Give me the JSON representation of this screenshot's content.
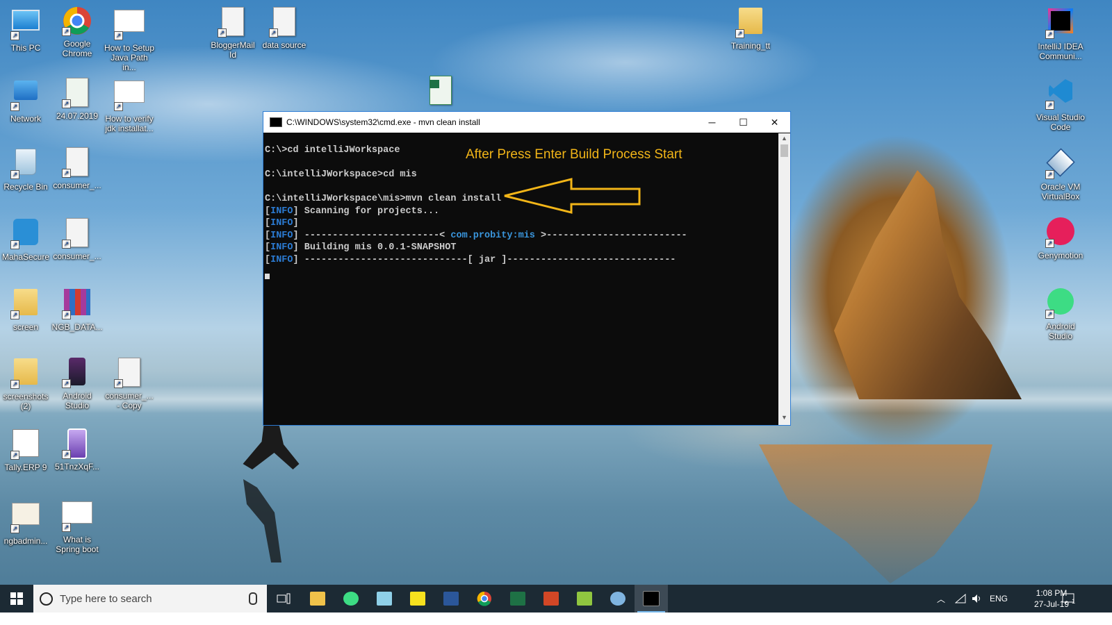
{
  "desktop": {
    "icons_left": [
      {
        "label": "This PC",
        "kind": "pc"
      },
      {
        "label": "Google Chrome",
        "kind": "chrome"
      },
      {
        "label": "How to Setup Java Path in...",
        "kind": "image"
      },
      {
        "label": "Network",
        "kind": "network"
      },
      {
        "label": "24.07.2019",
        "kind": "excel"
      },
      {
        "label": "How to verify jdk installat...",
        "kind": "image"
      },
      {
        "label": "Recycle Bin",
        "kind": "recycle"
      },
      {
        "label": "consumer_...",
        "kind": "doc"
      },
      {
        "label": "MahaSecure",
        "kind": "lock"
      },
      {
        "label": "consumer_...",
        "kind": "doc"
      },
      {
        "label": "screen",
        "kind": "folder"
      },
      {
        "label": "NGB_DATA...",
        "kind": "winrar"
      },
      {
        "label": "screenshots (2)",
        "kind": "folder"
      },
      {
        "label": "Android Studio",
        "kind": "phone"
      },
      {
        "label": "consumer_... - Copy",
        "kind": "doc"
      },
      {
        "label": "Tally.ERP 9",
        "kind": "tally"
      },
      {
        "label": "51TnzXqF...",
        "kind": "phone2"
      },
      {
        "label": "ngbadmin...",
        "kind": "cert"
      },
      {
        "label": "What is Spring boot",
        "kind": "image"
      }
    ],
    "icons_top": [
      {
        "label": "BloggerMail Id",
        "kind": "doc"
      },
      {
        "label": "data source",
        "kind": "doc"
      },
      {
        "label": "Training_tt",
        "kind": "folder"
      }
    ],
    "icons_right": [
      {
        "label": "IntelliJ IDEA Communi...",
        "kind": "intellij"
      },
      {
        "label": "Visual Studio Code",
        "kind": "vscode"
      },
      {
        "label": "Oracle VM VirtualBox",
        "kind": "vbox"
      },
      {
        "label": "Genymotion",
        "kind": "geny"
      },
      {
        "label": "Android Studio",
        "kind": "android"
      }
    ]
  },
  "cmd": {
    "title": "C:\\WINDOWS\\system32\\cmd.exe - mvn  clean install",
    "lines": {
      "l1": "C:\\>cd intelliJWorkspace",
      "l2": "C:\\intelliJWorkspace>cd mis",
      "l3": "C:\\intelliJWorkspace\\mis>mvn clean install",
      "info": "INFO",
      "l4_text": " Scanning for projects...",
      "l6_pre": " ------------------------< ",
      "l6_artifact": "com.probity:mis",
      "l6_post": " >-------------------------",
      "l7_text": " Building mis 0.0.1-SNAPSHOT",
      "l8_text": " -----------------------------[ jar ]------------------------------"
    },
    "minimize": "─",
    "maximize": "☐",
    "close": "✕"
  },
  "annotation": "After Press Enter Build Process Start",
  "taskbar": {
    "search_placeholder": "Type here to search",
    "apps": [
      "task-view",
      "file-explorer",
      "android-studio",
      "notepad",
      "sticky-notes",
      "word",
      "chrome",
      "excel",
      "office",
      "notepad-plus",
      "settings",
      "cmd"
    ],
    "language": "ENG",
    "time": "1:08 PM",
    "date": "27-Jul-19",
    "notification_count": "1"
  }
}
